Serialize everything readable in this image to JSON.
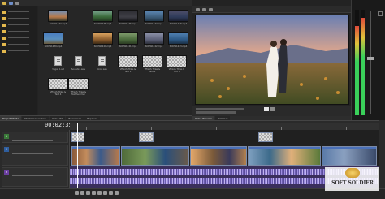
{
  "explorer": {
    "tiles": [
      {
        "label": "SOOW1234.mp4"
      },
      {
        "label": "SOOW1235.mp4"
      },
      {
        "label": "SOOW1236.mp4"
      },
      {
        "label": "SOOW1237.mp4"
      },
      {
        "label": "SOOW1238.mp4"
      },
      {
        "label": "SOOW1239.mp4"
      },
      {
        "label": "SOOW1240.mp4"
      },
      {
        "label": "SOOW1241.mp4"
      },
      {
        "label": "SOOW1242.mp4"
      },
      {
        "label": "SOOW1243.mp4"
      },
      {
        "label": "Vegas 1.srt"
      },
      {
        "label": "Sounds1.wav"
      },
      {
        "label": "Voice.wav"
      },
      {
        "label": "VEGAS Titles & Text 1"
      },
      {
        "label": "VEGAS Titles & Text 2"
      },
      {
        "label": "VEGAS Titles & Text 3"
      },
      {
        "label": "VEGAS Titles & Text 4"
      },
      {
        "label": "VEGAS Titles & Text Summer"
      }
    ]
  },
  "left_tabs": [
    "Project Media",
    "Media Generators",
    "Video FX",
    "Transitions",
    "Explorer"
  ],
  "right_tabs": [
    "Video Preview",
    "Trimmer"
  ],
  "timeline": {
    "timecode": "00:02:35;05"
  },
  "watermark": {
    "text": "SOFT SOLDIER"
  }
}
